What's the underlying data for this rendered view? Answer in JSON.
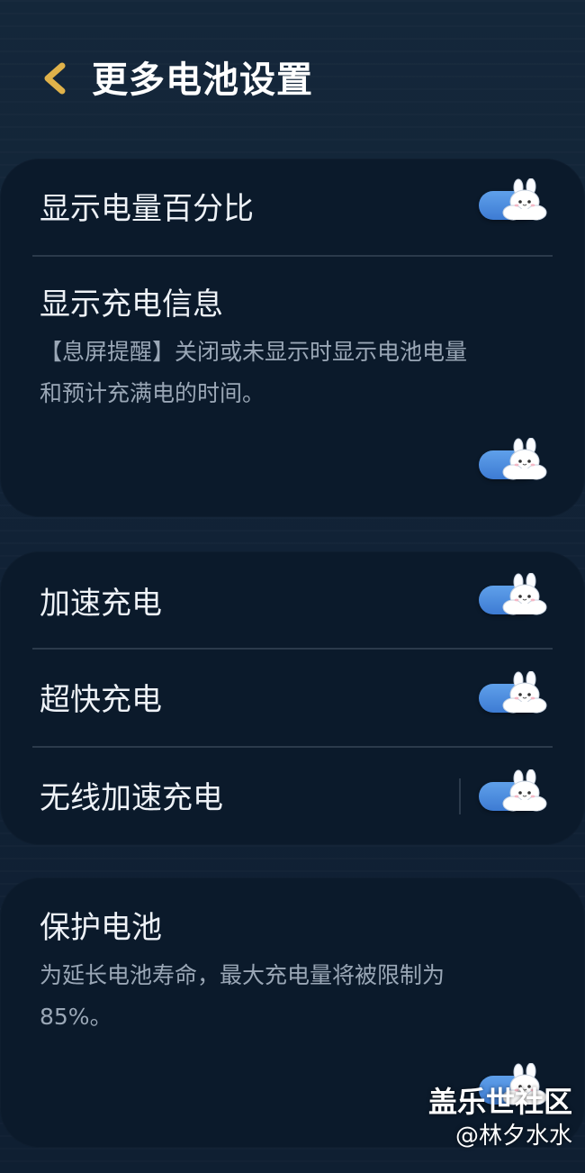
{
  "header": {
    "title": "更多电池设置"
  },
  "group1": {
    "show_percentage": {
      "label": "显示电量百分比",
      "on": true
    },
    "show_charging_info": {
      "label": "显示充电信息",
      "description_line1": "【息屏提醒】关闭或未显示时显示电池电量",
      "description_line2": "和预计充满电的时间。",
      "on": true
    }
  },
  "group2": {
    "fast_charging": {
      "label": "加速充电",
      "on": true
    },
    "super_fast_charging": {
      "label": "超快充电",
      "on": true
    },
    "fast_wireless_charging": {
      "label": "无线加速充电",
      "on": true
    }
  },
  "group3": {
    "protect_battery": {
      "label": "保护电池",
      "description_line1": "为延长电池寿命，最大充电量将被限制为",
      "description_line2": "85%。",
      "on": true
    }
  },
  "watermark": {
    "site": "盖乐世社区",
    "user": "@林夕水水"
  },
  "colors": {
    "toggle_on": "#4a8be0",
    "card_bg": "#0b1a2b",
    "accent_gold": "#e0b24a"
  },
  "icons": {
    "back": "chevron-left-icon",
    "toggle_thumb": "bunny-thumb-icon"
  }
}
